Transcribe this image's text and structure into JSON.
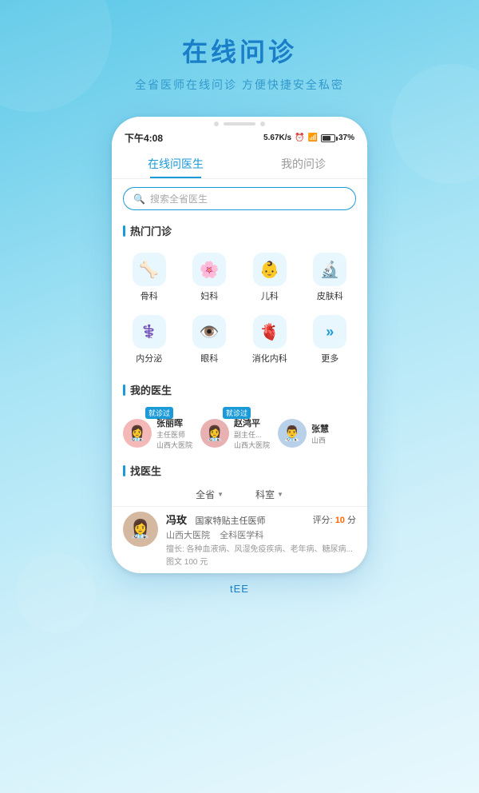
{
  "page": {
    "title": "在线问诊",
    "subtitle": "全省医师在线问诊  方便快捷安全私密"
  },
  "statusBar": {
    "time": "下午4:08",
    "network": "5.67K/s",
    "battery": "37%"
  },
  "tabs": [
    {
      "id": "online",
      "label": "在线问医生",
      "active": true
    },
    {
      "id": "mycons",
      "label": "我的问诊",
      "active": false
    }
  ],
  "search": {
    "placeholder": "搜索全省医生"
  },
  "hotDept": {
    "title": "热门门诊",
    "items": [
      {
        "id": "bone",
        "icon": "🦴",
        "label": "骨科"
      },
      {
        "id": "gyn",
        "icon": "🌸",
        "label": "妇科"
      },
      {
        "id": "pedi",
        "icon": "👶",
        "label": "儿科"
      },
      {
        "id": "derm",
        "icon": "🔬",
        "label": "皮肤科"
      },
      {
        "id": "endo",
        "icon": "⚕️",
        "label": "内分泌"
      },
      {
        "id": "eye",
        "icon": "👁️",
        "label": "眼科"
      },
      {
        "id": "diges",
        "icon": "🫀",
        "label": "消化内科"
      },
      {
        "id": "more",
        "icon": "»",
        "label": "更多"
      }
    ]
  },
  "myDoctors": {
    "title": "我的医生",
    "items": [
      {
        "name": "张丽晖",
        "badge": "就诊过",
        "title": "主任医师",
        "hospital": "山西大医院",
        "avatar": "👩‍⚕️",
        "avatarBg": "#f5b8b8"
      },
      {
        "name": "赵鸿平",
        "badge": "就诊过",
        "title": "副主任...",
        "hospital": "山西大医院",
        "avatar": "👩‍⚕️",
        "avatarBg": "#e8b0b0"
      },
      {
        "name": "张慧",
        "badge": "",
        "title": "",
        "hospital": "山西",
        "avatar": "👨‍⚕️",
        "avatarBg": "#b8d0e8"
      }
    ]
  },
  "findDoctor": {
    "title": "找医生",
    "filters": [
      {
        "id": "province",
        "label": "全省"
      },
      {
        "id": "dept",
        "label": "科室"
      }
    ],
    "items": [
      {
        "name": "冯玫",
        "title": "国家特贴主任医师",
        "hospital": "山西大医院",
        "dept": "全科医学科",
        "specialty": "擅长: 各种血液病、风湿免疫疾病、老年病、糖尿病...",
        "price": "图文 100 元",
        "score": "10",
        "avatar": "👩‍⚕️",
        "avatarBg": "#d4b8a0"
      }
    ]
  },
  "bottomHint": "tEE"
}
